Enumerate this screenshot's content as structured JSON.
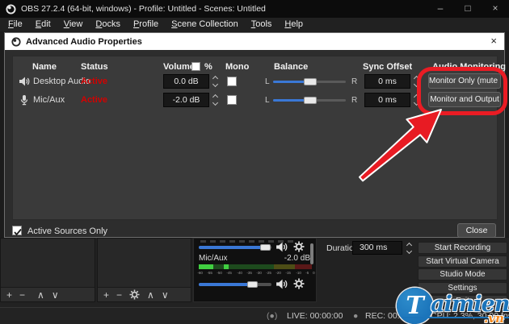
{
  "titlebar": {
    "title": "OBS 27.2.4 (64-bit, windows) - Profile: Untitled - Scenes: Untitled",
    "minimize": "–",
    "maximize": "□",
    "close": "×"
  },
  "menu": {
    "items": [
      "File",
      "Edit",
      "View",
      "Docks",
      "Profile",
      "Scene Collection",
      "Tools",
      "Help"
    ]
  },
  "dialog": {
    "title": "Advanced Audio Properties",
    "close": "×",
    "headers": {
      "name": "Name",
      "status": "Status",
      "volume": "Volume",
      "percent": "%",
      "mono": "Mono",
      "balance": "Balance",
      "sync": "Sync Offset",
      "monitoring": "Audio Monitoring"
    },
    "rows": [
      {
        "name": "Desktop Audio",
        "status": "Active",
        "volume": "0.0 dB",
        "left": "L",
        "right": "R",
        "sync": "0 ms",
        "monitoring": "Monitor Only (mute ou"
      },
      {
        "name": "Mic/Aux",
        "status": "Active",
        "volume": "-2.0 dB",
        "left": "L",
        "right": "R",
        "sync": "0 ms",
        "monitoring": "Monitor and Output"
      }
    ],
    "footer": {
      "active_sources": "Active Sources Only",
      "close_button": "Close"
    }
  },
  "main": {
    "duration": {
      "label": "Duration",
      "value": "300 ms"
    },
    "control_buttons": [
      "Start Recording",
      "Start Virtual Camera",
      "Studio Mode",
      "Settings",
      "Exit"
    ],
    "mixer": {
      "source_label": "Mic/Aux",
      "source_db": "-2.0 dB",
      "ticks": [
        "-60",
        "-55",
        "-50",
        "-45",
        "-40",
        "-35",
        "-30",
        "-25",
        "-20",
        "-15",
        "-10",
        "-5",
        "0"
      ]
    },
    "dock_toolbar": {
      "add": "+",
      "remove": "−",
      "up": "∧",
      "down": "∨"
    },
    "status": {
      "live_icon": "(●)",
      "live": "LIVE: 00:00:00",
      "rec_icon": "●",
      "rec": "REC: 00:00:00",
      "cpu": "CPU: 2.3%, 30.00 fps"
    }
  },
  "watermark": {
    "initial": "T",
    "text": "aimienphi",
    "tld": ".vn"
  },
  "colors": {
    "accent_blue": "#3a78d6",
    "active_red": "#d40000",
    "annotation_red": "#ea1c24",
    "watermark_blue": "#1b74ba",
    "watermark_orange": "#f68b1f",
    "meter_green": "#41cf41"
  }
}
